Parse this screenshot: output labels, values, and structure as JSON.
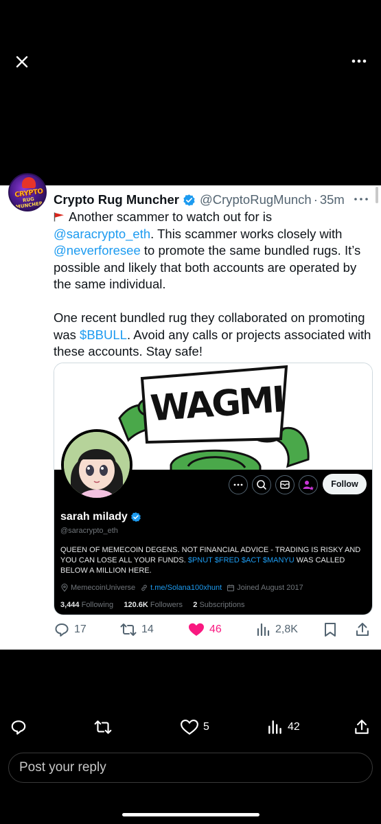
{
  "viewer": {
    "close_icon": "close-icon",
    "more_icon": "more-horizontal-icon"
  },
  "tweet": {
    "author": "Crypto Rug Muncher",
    "handle": "@CryptoRugMunch",
    "separator": "·",
    "time": "35m",
    "avatar_text_top": "CRYPTO",
    "avatar_text_bottom": "RUG MUNCHER",
    "text": {
      "line1": "Another scammer to watch out for is",
      "mention1": "@saracrypto_eth",
      "line2": ". This scammer works closely with",
      "mention2": "@neverforesee",
      "line3": " to promote the same bundled rugs. It’s possible and likely that both accounts are operated by the same individual.",
      "line4": "One recent bundled rug they collaborated on promoting was ",
      "cashtag": "$BBULL",
      "line5": ".  Avoid any calls or projects associated with these accounts. Stay safe!"
    },
    "actions": {
      "replies": "17",
      "retweets": "14",
      "likes": "46",
      "views": "2,8K"
    }
  },
  "quoted_profile": {
    "banner_text": "WAGMI",
    "follow_label": "Follow",
    "name": "sarah milady",
    "handle": "@saracrypto_eth",
    "bio_text": "QUEEN OF MEMECOIN DEGENS. NOT FINANCIAL ADVICE - TRADING IS RISKY AND YOU CAN LOSE ALL YOUR FUNDS. ",
    "bio_tags": "$PNUT $FRED $ACT $MANYU",
    "bio_end": " WAS CALLED BELOW A MILLION HERE.",
    "location": "MemecoinUniverse",
    "website": "t.me/Solana100xhunt",
    "joined": "Joined August 2017",
    "following_count": "3,444",
    "following_label": "Following",
    "followers_count": "120.6K",
    "followers_label": "Followers",
    "subscriptions_count": "2",
    "subscriptions_label": "Subscriptions"
  },
  "bottom_bar": {
    "likes": "5",
    "views": "42",
    "reply_placeholder": "Post your reply"
  },
  "colors": {
    "accent": "#1d9bf0",
    "like": "#f91880",
    "muted": "#536471"
  }
}
